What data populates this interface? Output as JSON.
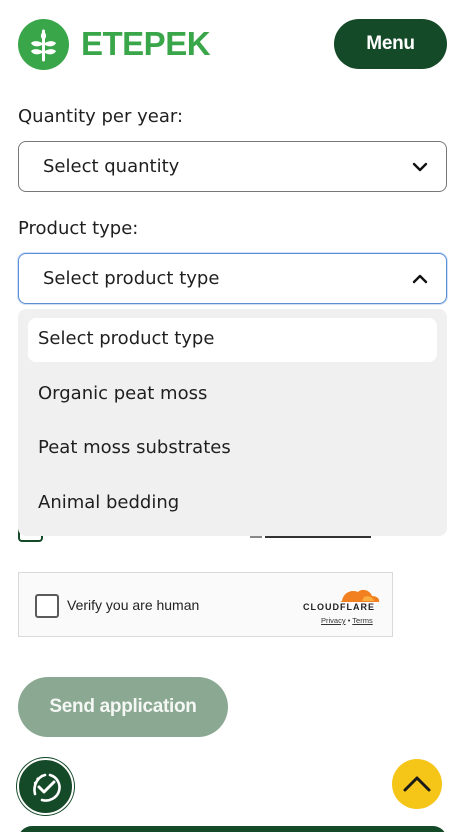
{
  "header": {
    "brand": "ETEPEK",
    "menu_label": "Menu"
  },
  "form": {
    "quantity": {
      "label": "Quantity per year:",
      "value": "Select quantity"
    },
    "product_type": {
      "label": "Product type:",
      "value": "Select product type",
      "options": [
        "Select product type",
        "Organic peat moss",
        "Peat moss substrates",
        "Animal bedding"
      ],
      "selected_index": 0
    },
    "captcha": {
      "label": "Verify you are human",
      "provider": "CLOUDFLARE",
      "privacy": "Privacy",
      "separator": "•",
      "terms": "Terms"
    },
    "submit_label": "Send application"
  },
  "colors": {
    "brand_green": "#3aa64a",
    "dark_green": "#154a28",
    "disabled_button": "#8aa892",
    "scroll_top": "#f5c518",
    "cloudflare_orange": "#f38020"
  },
  "icons": {
    "logo": "wheat-leaf-icon",
    "select_closed": "chevron-down-icon",
    "select_open": "chevron-up-icon",
    "accessibility": "accessibility-icon",
    "scroll_top": "chevron-up-icon"
  }
}
